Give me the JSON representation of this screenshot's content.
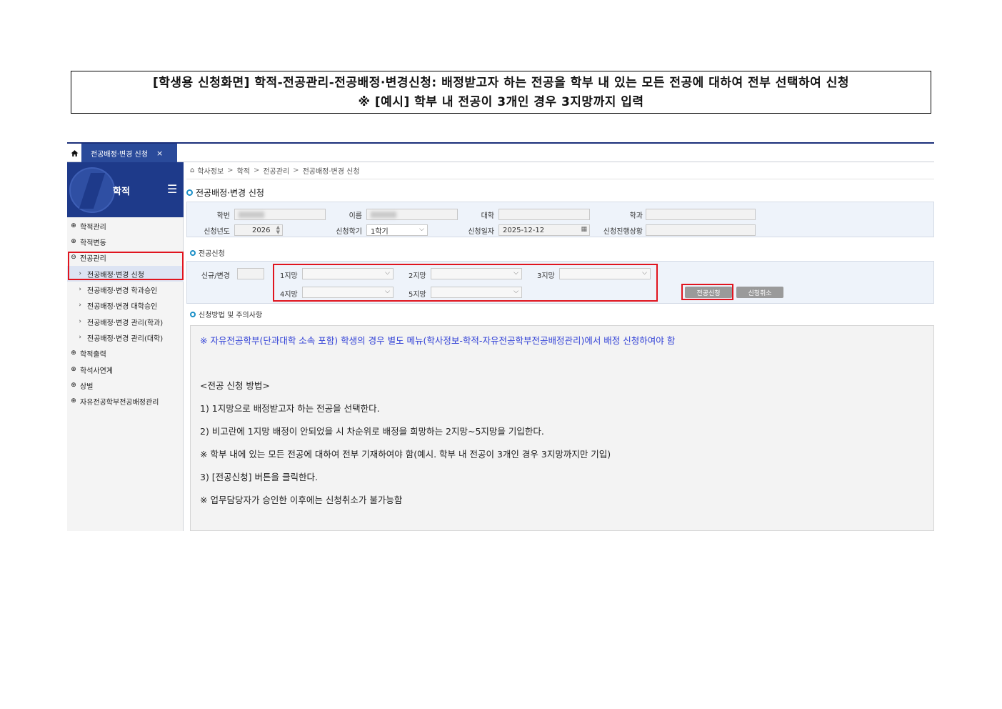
{
  "caption": {
    "line1": "[학생용 신청화면] 학적-전공관리-전공배정·변경신청: 배정받고자 하는 전공을 학부 내 있는 모든 전공에 대하여 전부 선택하여 신청",
    "line2": "※ [예시] 학부 내 전공이 3개인 경우 3지망까지 입력"
  },
  "tabbar": {
    "home_icon": "home-icon",
    "tab_label": "전공배정·변경 신청",
    "tab_close": "×"
  },
  "sidebar": {
    "title": "학적",
    "menu_icon": "☰",
    "items": [
      {
        "label": "학적관리",
        "bullet": "⊕"
      },
      {
        "label": "학적변동",
        "bullet": "⊕"
      },
      {
        "label": "전공관리",
        "bullet": "⊖"
      },
      {
        "label": "전공배정·변경 신청",
        "sub": "›"
      },
      {
        "label": "전공배정·변경 학과승인",
        "sub": "›"
      },
      {
        "label": "전공배정·변경 대학승인",
        "sub": "›"
      },
      {
        "label": "전공배정·변경 관리(학과)",
        "sub": "›"
      },
      {
        "label": "전공배정·변경 관리(대학)",
        "sub": "›"
      },
      {
        "label": "학적출력",
        "bullet": "⊕"
      },
      {
        "label": "학석사연계",
        "bullet": "⊕"
      },
      {
        "label": "상벌",
        "bullet": "⊕"
      },
      {
        "label": "자유전공학부전공배정관리",
        "bullet": "⊕"
      }
    ]
  },
  "breadcrumb": {
    "home": "⌂",
    "items": [
      "학사정보",
      "학적",
      "전공관리",
      "전공배정·변경 신청"
    ],
    "sep": ">"
  },
  "page_title": "전공배정·변경 신청",
  "info": {
    "student_no_label": "학번",
    "name_label": "이름",
    "college_label": "대학",
    "dept_label": "학과",
    "year_label": "신청년도",
    "year_value": "2026",
    "semester_label": "신청학기",
    "semester_value": "1학기",
    "date_label": "신청일자",
    "date_value": "2025-12-12",
    "status_label": "신청진행상황"
  },
  "apply": {
    "section_title": "전공신청",
    "type_label": "신규/변경",
    "choice1": "1지망",
    "choice2": "2지망",
    "choice3": "3지망",
    "choice4": "4지망",
    "choice5": "5지망",
    "apply_button": "전공신청",
    "cancel_button": "신청취소"
  },
  "notes": {
    "section_title": "신청방법 및 주의사항",
    "line1": "※ 자유전공학부(단과대학 소속 포함) 학생의 경우 별도 메뉴(학사정보-학적-자유전공학부전공배정관리)에서 배정 신청하여야 함",
    "line2": "<전공 신청 방법>",
    "line3": "1) 1지망으로 배정받고자 하는 전공을 선택한다.",
    "line4": "2) 비고란에 1지망 배정이 안되었을 시 차순위로 배정을 희망하는 2지망~5지망을 기입한다.",
    "line5": "※ 학부 내에 있는 모든 전공에 대하여 전부 기재하여야 함(예시. 학부 내 전공이 3개인 경우 3지망까지만 기입)",
    "line6": "3) [전공신청] 버튼을 클릭한다.",
    "line7": "※ 업무담당자가 승인한 이후에는 신청취소가 불가능함"
  },
  "colors": {
    "sidebar_head": "#1e3a8a",
    "tab_active": "#2a4a9a",
    "highlight": "#e0141e",
    "note_blue": "#2f3fd6"
  }
}
